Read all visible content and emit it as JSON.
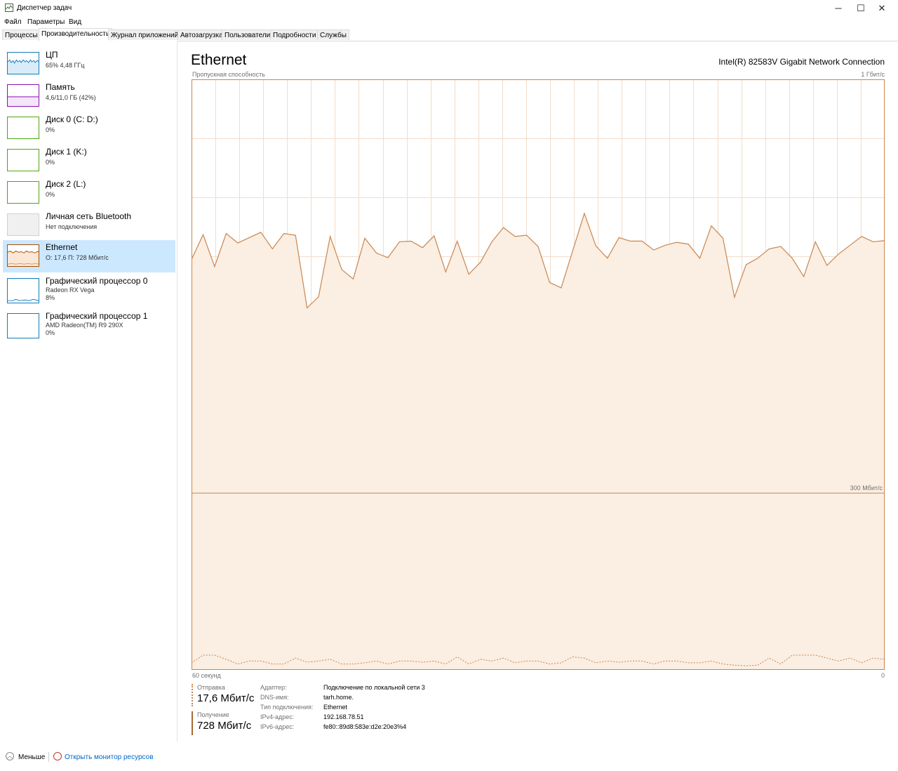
{
  "window": {
    "title": "Диспетчер задач",
    "minimize": "─",
    "maximize": "☐",
    "close": "✕"
  },
  "menu": [
    "Файл",
    "Параметры",
    "Вид"
  ],
  "tabs": [
    "Процессы",
    "Производительность",
    "Журнал приложений",
    "Автозагрузка",
    "Пользователи",
    "Подробности",
    "Службы"
  ],
  "active_tab": "Производительность",
  "sidebar": [
    {
      "title": "ЦП",
      "sub": "65% 4,48 ГГц",
      "color": "#117dbb"
    },
    {
      "title": "Память",
      "sub": "4,6/11,0 ГБ (42%)",
      "color": "#8b12ae"
    },
    {
      "title": "Диск 0 (C: D:)",
      "sub": "0%",
      "color": "#4da60c"
    },
    {
      "title": "Диск 1 (K:)",
      "sub": "0%",
      "color": "#4da60c"
    },
    {
      "title": "Диск 2 (L:)",
      "sub": "0%",
      "color": "#4da60c"
    },
    {
      "title": "Личная сеть Bluetooth",
      "sub": "Нет подключения",
      "color": "#d0d0d0"
    },
    {
      "title": "Ethernet",
      "sub": "О: 17,6 П: 728 Мбит/с",
      "color": "#a74f01"
    },
    {
      "title": "Графический процессор 0",
      "sub": "Radeon RX Vega",
      "sub2": "8%",
      "color": "#117dbb"
    },
    {
      "title": "Графический процессор 1",
      "sub": "AMD Radeon(TM) R9 290X",
      "sub2": "0%",
      "color": "#117dbb"
    }
  ],
  "main": {
    "title": "Ethernet",
    "adapter": "Intel(R) 82583V Gigabit Network Connection",
    "capacity_label": "Пропускная способность",
    "max_label": "1 Гбит/с",
    "mid_label": "300 Мбит/с",
    "x_left": "60 секунд",
    "x_right": "0",
    "send_label": "Отправка",
    "send_value": "17,6 Мбит/с",
    "recv_label": "Получение",
    "recv_value": "728 Мбит/с",
    "props": [
      {
        "k": "Адаптер:",
        "v": "Подключение по локальной сети 3"
      },
      {
        "k": "DNS-имя:",
        "v": "tarh.home."
      },
      {
        "k": "Тип подключения:",
        "v": "Ethernet"
      },
      {
        "k": "IPv4-адрес:",
        "v": "192.168.78.51"
      },
      {
        "k": "IPv6-адрес:",
        "v": "fe80::89d8:583e:d2e:20e3%4"
      }
    ]
  },
  "chart_data": {
    "type": "area",
    "y_unit": "Мбит/с",
    "ylim": [
      0,
      1000
    ],
    "x_range_seconds": [
      60,
      0
    ],
    "series": [
      {
        "name": "Получение",
        "style": "solid",
        "color": "#a74f01",
        "values": [
          695,
          737,
          683,
          739,
          723,
          732,
          741,
          713,
          739,
          736,
          613,
          632,
          734,
          678,
          662,
          731,
          706,
          698,
          725,
          726,
          715,
          735,
          674,
          726,
          670,
          690,
          725,
          749,
          734,
          736,
          717,
          656,
          647,
          710,
          773,
          718,
          697,
          732,
          726,
          726,
          711,
          719,
          724,
          721,
          697,
          752,
          731,
          631,
          686,
          697,
          713,
          717,
          697,
          666,
          725,
          685,
          704,
          719,
          734,
          725,
          727
        ],
        "note_midline": 300
      },
      {
        "name": "Отправка",
        "style": "dotted",
        "color": "#a74f01",
        "values": [
          12,
          25,
          25,
          18,
          10,
          15,
          15,
          10,
          10,
          20,
          13,
          15,
          18,
          10,
          10,
          12,
          15,
          10,
          15,
          15,
          13,
          15,
          10,
          22,
          10,
          18,
          15,
          20,
          12,
          15,
          15,
          10,
          12,
          22,
          20,
          12,
          15,
          13,
          15,
          15,
          10,
          15,
          15,
          12,
          12,
          15,
          10,
          8,
          7,
          8,
          20,
          10,
          25,
          25,
          25,
          20,
          15,
          20,
          12,
          20,
          18
        ]
      }
    ]
  }
}
